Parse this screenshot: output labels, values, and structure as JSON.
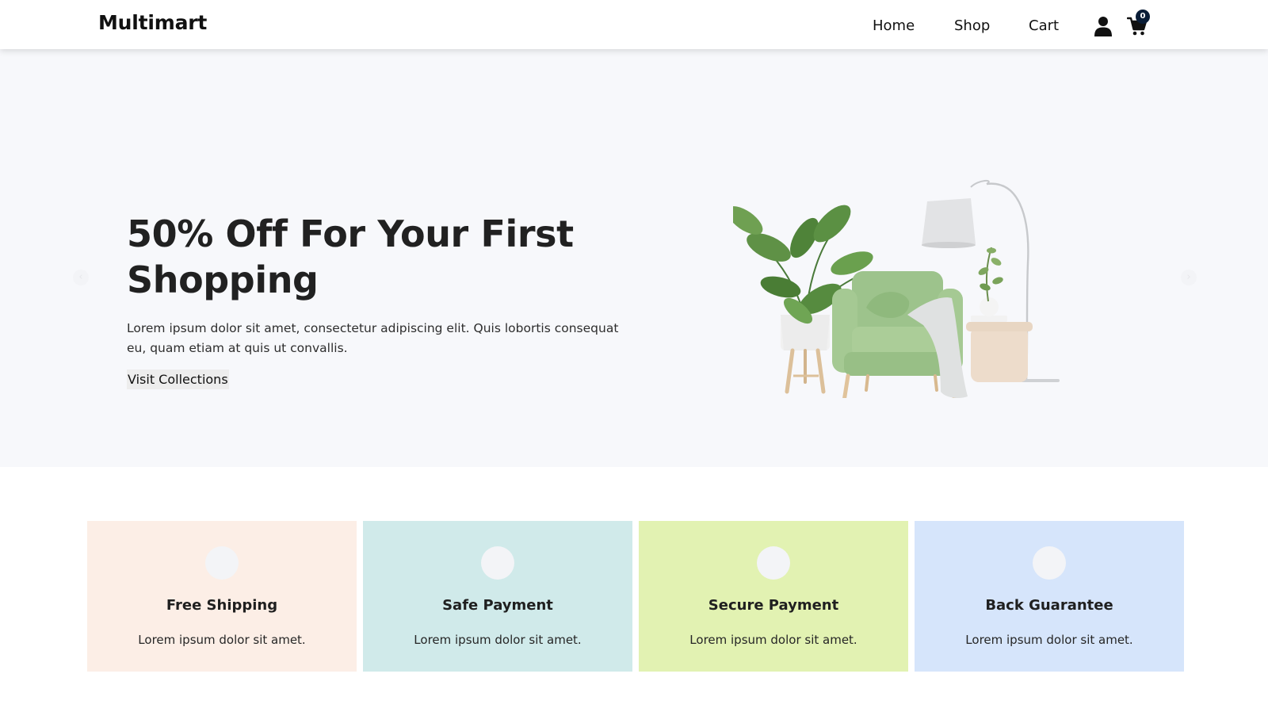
{
  "navbar": {
    "brand": "Multimart",
    "links": {
      "home": "Home",
      "shop": "Shop",
      "cart": "Cart"
    },
    "icons": {
      "user": "user-icon",
      "cart": "shopping-cart-icon"
    },
    "cart_count": "0",
    "badge_color": "#0a1d37"
  },
  "hero": {
    "title": "50% Off For Your First Shopping",
    "description": "Lorem ipsum dolor sit amet, consectetur adipiscing elit. Quis lobortis consequat eu, quam etiam at quis ut convallis.",
    "cta": "Visit Collections",
    "background": "#f7f8fb",
    "arrows": {
      "prev_icon": "chevron-left-icon",
      "next_icon": "chevron-right-icon"
    }
  },
  "services": [
    {
      "title": "Free Shipping",
      "description": "Lorem ipsum dolor sit amet.",
      "bg": "#fceee6"
    },
    {
      "title": "Safe Payment",
      "description": "Lorem ipsum dolor sit amet.",
      "bg": "#d0eaea"
    },
    {
      "title": "Secure Payment",
      "description": "Lorem ipsum dolor sit amet.",
      "bg": "#e2f2b2"
    },
    {
      "title": "Back Guarantee",
      "description": "Lorem ipsum dolor sit amet.",
      "bg": "#d6e5fb"
    }
  ]
}
